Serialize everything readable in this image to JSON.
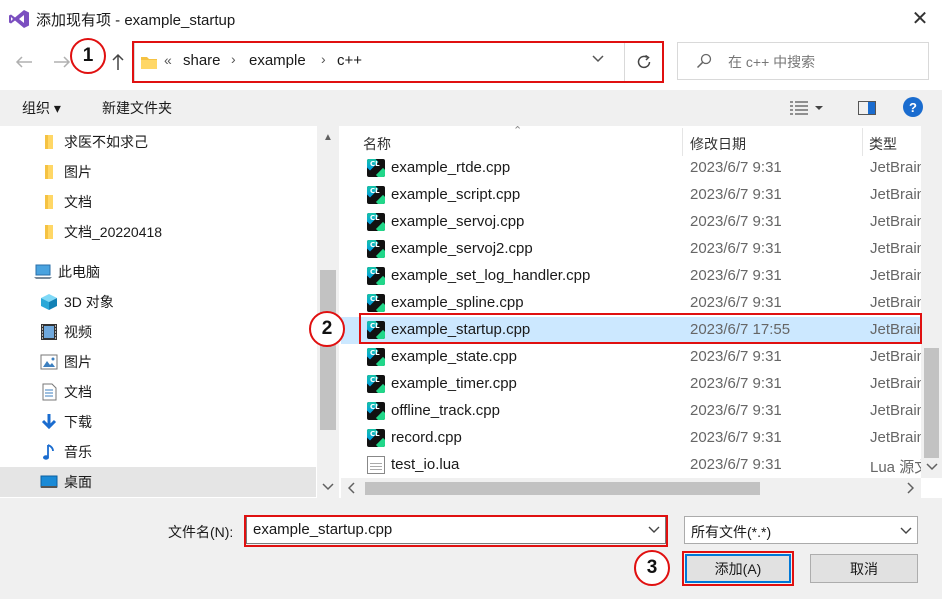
{
  "window": {
    "title": "添加现有项 - example_startup",
    "icon": "visual-studio-icon",
    "close": "✕"
  },
  "nav": {
    "breadcrumb_prefix": "«",
    "breadcrumbs": [
      "share",
      "example",
      "c++"
    ],
    "search_placeholder": "在 c++ 中搜索"
  },
  "toolbar": {
    "organize": "组织 ▾",
    "new_folder": "新建文件夹",
    "help": "?"
  },
  "tree": {
    "items": [
      {
        "label": "求医不如求己",
        "icon": "folder-icon"
      },
      {
        "label": "图片",
        "icon": "folder-icon"
      },
      {
        "label": "文档",
        "icon": "folder-icon"
      },
      {
        "label": "文档_20220418",
        "icon": "folder-icon"
      },
      {
        "label": "此电脑",
        "icon": "computer-icon"
      },
      {
        "label": "3D 对象",
        "icon": "cube-icon"
      },
      {
        "label": "视频",
        "icon": "video-icon"
      },
      {
        "label": "图片",
        "icon": "picture-icon"
      },
      {
        "label": "文档",
        "icon": "document-icon"
      },
      {
        "label": "下载",
        "icon": "download-icon"
      },
      {
        "label": "音乐",
        "icon": "music-icon"
      },
      {
        "label": "桌面",
        "icon": "desktop-icon"
      }
    ]
  },
  "list": {
    "columns": {
      "name": "名称",
      "date": "修改日期",
      "type": "类型"
    },
    "rows": [
      {
        "name": "example_rtde.cpp",
        "date": "2023/6/7 9:31",
        "type": "JetBrain"
      },
      {
        "name": "example_script.cpp",
        "date": "2023/6/7 9:31",
        "type": "JetBrain"
      },
      {
        "name": "example_servoj.cpp",
        "date": "2023/6/7 9:31",
        "type": "JetBrain"
      },
      {
        "name": "example_servoj2.cpp",
        "date": "2023/6/7 9:31",
        "type": "JetBrain"
      },
      {
        "name": "example_set_log_handler.cpp",
        "date": "2023/6/7 9:31",
        "type": "JetBrain"
      },
      {
        "name": "example_spline.cpp",
        "date": "2023/6/7 9:31",
        "type": "JetBrain"
      },
      {
        "name": "example_startup.cpp",
        "date": "2023/6/7 17:55",
        "type": "JetBrain"
      },
      {
        "name": "example_state.cpp",
        "date": "2023/6/7 9:31",
        "type": "JetBrain"
      },
      {
        "name": "example_timer.cpp",
        "date": "2023/6/7 9:31",
        "type": "JetBrain"
      },
      {
        "name": "offline_track.cpp",
        "date": "2023/6/7 9:31",
        "type": "JetBrain"
      },
      {
        "name": "record.cpp",
        "date": "2023/6/7 9:31",
        "type": "JetBrain"
      },
      {
        "name": "test_io.lua",
        "date": "2023/6/7 9:31",
        "type": "Lua 源文"
      }
    ]
  },
  "bottom": {
    "filename_label": "文件名(N):",
    "filename_value": "example_startup.cpp",
    "filetype_value": "所有文件(*.*)",
    "add_button": "添加(A)",
    "cancel_button": "取消"
  },
  "callouts": [
    "1",
    "2",
    "3"
  ],
  "colors": {
    "accent": "#0078d7",
    "callout": "#e01010",
    "selection": "#cce8ff"
  }
}
